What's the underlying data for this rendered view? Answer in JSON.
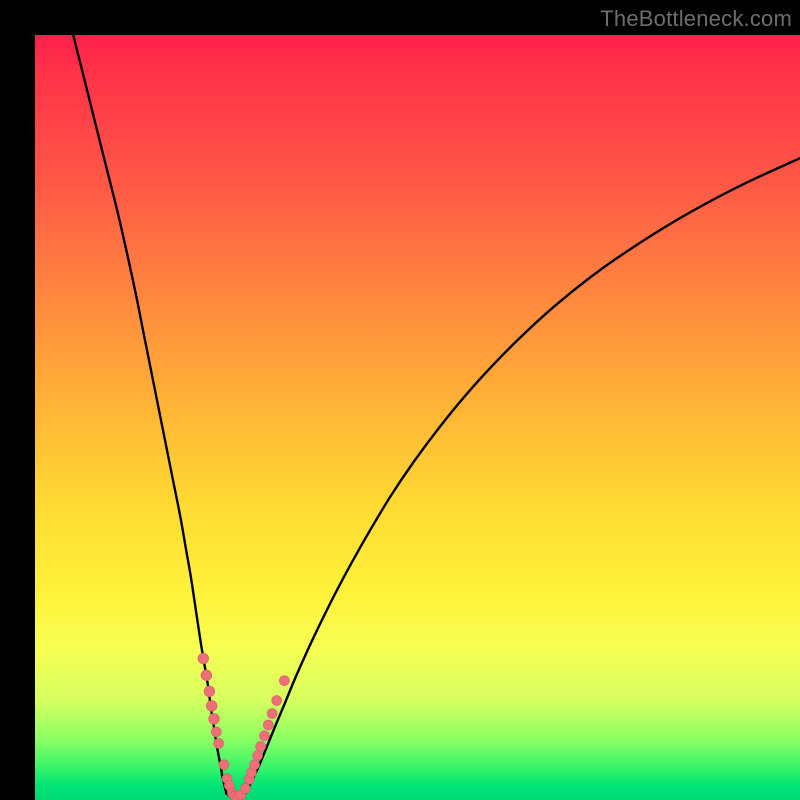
{
  "watermark": {
    "text": "TheBottleneck.com"
  },
  "colors": {
    "curve": "#000000",
    "marker_fill": "#ef6f79",
    "marker_stroke": "#d85965",
    "background_black": "#000000"
  },
  "chart_data": {
    "type": "line",
    "title": "",
    "xlabel": "",
    "ylabel": "",
    "xlim": [
      0,
      100
    ],
    "ylim": [
      0,
      100
    ],
    "grid": false,
    "legend": false,
    "series": [
      {
        "name": "left-branch",
        "x": [
          5,
          7,
          9,
          11,
          13,
          14,
          15,
          16,
          17,
          18,
          19,
          19.7,
          20.4,
          21.0,
          21.6,
          22.1,
          22.6,
          23.0,
          23.4,
          23.7,
          24.0,
          24.3,
          24.5,
          24.8,
          25.0
        ],
        "y": [
          100,
          92,
          84,
          76,
          67,
          62,
          57,
          52,
          47,
          42,
          37,
          33,
          29,
          25,
          21,
          18,
          15,
          12,
          9.5,
          7.5,
          5.8,
          4.3,
          3.0,
          1.8,
          0.9
        ]
      },
      {
        "name": "valley-floor",
        "x": [
          25.0,
          25.5,
          26.0,
          26.5,
          27.0,
          27.5
        ],
        "y": [
          0.9,
          0.45,
          0.2,
          0.2,
          0.45,
          0.9
        ]
      },
      {
        "name": "right-branch",
        "x": [
          27.5,
          28.3,
          29.2,
          30.2,
          31.3,
          32.6,
          34.0,
          35.6,
          37.4,
          39.4,
          41.6,
          44.0,
          46.6,
          49.5,
          52.7,
          56.2,
          60.0,
          64.2,
          68.8,
          73.9,
          79.5,
          85.6,
          92.4,
          100.0
        ],
        "y": [
          0.9,
          2.4,
          4.3,
          6.7,
          9.4,
          12.5,
          15.9,
          19.5,
          23.3,
          27.3,
          31.4,
          35.6,
          39.9,
          44.2,
          48.5,
          52.8,
          57.0,
          61.2,
          65.3,
          69.3,
          73.1,
          76.8,
          80.4,
          83.9
        ]
      }
    ],
    "markers": [
      {
        "x": 22.0,
        "y": 18.5,
        "size": 1.4
      },
      {
        "x": 22.4,
        "y": 16.3,
        "size": 1.4
      },
      {
        "x": 22.8,
        "y": 14.2,
        "size": 1.4
      },
      {
        "x": 23.1,
        "y": 12.3,
        "size": 1.4
      },
      {
        "x": 23.4,
        "y": 10.6,
        "size": 1.4
      },
      {
        "x": 23.7,
        "y": 8.9,
        "size": 1.2
      },
      {
        "x": 24.0,
        "y": 7.4,
        "size": 1.0
      },
      {
        "x": 24.7,
        "y": 4.6,
        "size": 1.1
      },
      {
        "x": 25.1,
        "y": 2.8,
        "size": 1.2
      },
      {
        "x": 25.4,
        "y": 1.9,
        "size": 1.1
      },
      {
        "x": 25.8,
        "y": 0.9,
        "size": 1.3
      },
      {
        "x": 26.1,
        "y": 0.55,
        "size": 1.3
      },
      {
        "x": 26.5,
        "y": 0.45,
        "size": 1.3
      },
      {
        "x": 26.9,
        "y": 0.65,
        "size": 1.2
      },
      {
        "x": 27.5,
        "y": 1.5,
        "size": 1.1
      },
      {
        "x": 28.0,
        "y": 2.7,
        "size": 1.3
      },
      {
        "x": 28.3,
        "y": 3.6,
        "size": 1.3
      },
      {
        "x": 28.7,
        "y": 4.6,
        "size": 1.3
      },
      {
        "x": 29.1,
        "y": 5.8,
        "size": 1.3
      },
      {
        "x": 29.5,
        "y": 7.0,
        "size": 1.3
      },
      {
        "x": 30.0,
        "y": 8.4,
        "size": 1.3
      },
      {
        "x": 30.5,
        "y": 9.8,
        "size": 1.3
      },
      {
        "x": 31.0,
        "y": 11.3,
        "size": 1.3
      },
      {
        "x": 31.6,
        "y": 13.0,
        "size": 1.0
      },
      {
        "x": 32.6,
        "y": 15.6,
        "size": 1.0
      }
    ]
  }
}
